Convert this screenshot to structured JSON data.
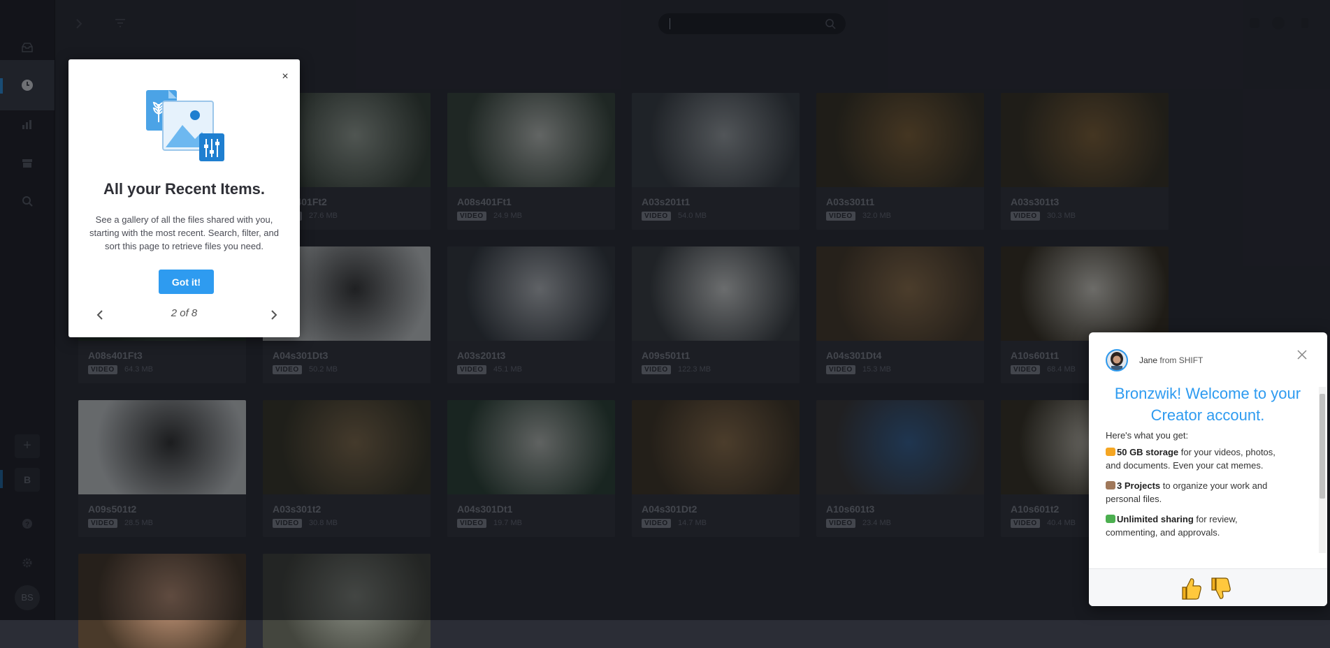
{
  "sidebar": {
    "add_label": "+",
    "workspace_initial": "B",
    "user_initials": "BS"
  },
  "search": {
    "placeholder": ""
  },
  "items": [
    {
      "name": "",
      "type": "",
      "size": ""
    },
    {
      "name": "A08s401Ft2",
      "type": "VIDEO",
      "size": "27.6 MB"
    },
    {
      "name": "A08s401Ft1",
      "type": "VIDEO",
      "size": "24.9 MB"
    },
    {
      "name": "A03s201t1",
      "type": "VIDEO",
      "size": "54.0 MB"
    },
    {
      "name": "A03s301t1",
      "type": "VIDEO",
      "size": "32.0 MB"
    },
    {
      "name": "A03s301t3",
      "type": "VIDEO",
      "size": "30.3 MB"
    },
    {
      "name": "A08s401Ft3",
      "type": "VIDEO",
      "size": "64.3 MB"
    },
    {
      "name": "A04s301Dt3",
      "type": "VIDEO",
      "size": "50.2 MB"
    },
    {
      "name": "A03s201t3",
      "type": "VIDEO",
      "size": "45.1 MB"
    },
    {
      "name": "A09s501t1",
      "type": "VIDEO",
      "size": "122.3 MB"
    },
    {
      "name": "A04s301Dt4",
      "type": "VIDEO",
      "size": "15.3 MB"
    },
    {
      "name": "A10s601t1",
      "type": "VIDEO",
      "size": "68.4 MB"
    },
    {
      "name": "A09s501t2",
      "type": "VIDEO",
      "size": "28.5 MB"
    },
    {
      "name": "A03s301t2",
      "type": "VIDEO",
      "size": "30.8 MB"
    },
    {
      "name": "A04s301Dt1",
      "type": "VIDEO",
      "size": "19.7 MB"
    },
    {
      "name": "A04s301Dt2",
      "type": "VIDEO",
      "size": "14.7 MB"
    },
    {
      "name": "A10s601t3",
      "type": "VIDEO",
      "size": "23.4 MB"
    },
    {
      "name": "A10s601t2",
      "type": "VIDEO",
      "size": "40.4 MB"
    },
    {
      "name": "",
      "type": "",
      "size": ""
    },
    {
      "name": "",
      "type": "",
      "size": ""
    }
  ],
  "tour": {
    "close_label": "×",
    "title": "All your Recent Items.",
    "body": "See a gallery of all the files shared with you, starting with the most recent. Search, filter, and sort this page to retrieve files you need.",
    "button_label": "Got it!",
    "step": "2 of 8"
  },
  "chat": {
    "sender_name": "Jane",
    "sender_org": "from SHIFT",
    "heading": "Bronzwik! Welcome to your Creator account.",
    "intro": "Here's what you get:",
    "features": [
      {
        "bold": "50 GB storage",
        "rest": " for your videos, photos, and documents. Even your cat memes.",
        "emoji_color": "#f5a623"
      },
      {
        "bold": "3 Projects",
        "rest": " to organize your work and personal files.",
        "emoji_color": "#a0785a"
      },
      {
        "bold": "Unlimited sharing",
        "rest": " for review, commenting, and approvals.",
        "emoji_color": "#4caf50"
      }
    ]
  },
  "colors": {
    "accent": "#2e9bf0",
    "background": "#2b2d36"
  }
}
